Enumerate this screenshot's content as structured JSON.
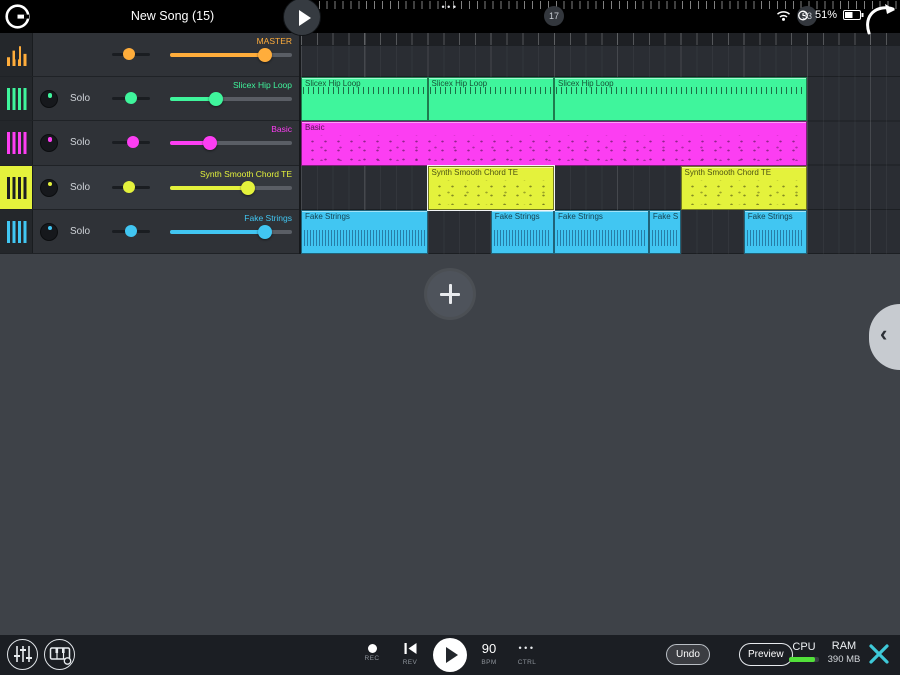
{
  "topbar": {
    "title": "New Song (15)",
    "menu_dots": "•••",
    "bar_badges": [
      {
        "label": "17",
        "bar": 17
      },
      {
        "label": "33",
        "bar": 33
      }
    ],
    "battery": "51%"
  },
  "tracks": [
    {
      "name": "MASTER",
      "color": "#FFAD3B",
      "icon": "level-meter",
      "solo": null,
      "pan": 0.45,
      "volume": 0.78
    },
    {
      "name": "Slicex Hip Loop",
      "color": "#3FF59C",
      "icon": "piano-roll",
      "solo": "Solo",
      "pan": 0.5,
      "volume": 0.38
    },
    {
      "name": "Basic",
      "color": "#FC3EF2",
      "icon": "piano-roll",
      "solo": "Solo",
      "pan": 0.55,
      "volume": 0.33
    },
    {
      "name": "Synth Smooth Chord TE",
      "color": "#E4F23C",
      "icon": "piano-roll",
      "solo": "Solo",
      "pan": 0.45,
      "volume": 0.64,
      "selected": true
    },
    {
      "name": "Fake Strings",
      "color": "#41C6F2",
      "icon": "piano-roll",
      "solo": "Solo",
      "pan": 0.5,
      "volume": 0.78
    }
  ],
  "clips": [
    {
      "row": 1,
      "bar": 1,
      "len": 8,
      "label": "Slicex Hip Loop",
      "kind": "slices"
    },
    {
      "row": 1,
      "bar": 9,
      "len": 8,
      "label": "Slicex Hip Loop",
      "kind": "slices"
    },
    {
      "row": 1,
      "bar": 17,
      "len": 16,
      "label": "Slicex Hip Loop",
      "kind": "slices"
    },
    {
      "row": 2,
      "bar": 1,
      "len": 32,
      "label": "Basic",
      "kind": "notes"
    },
    {
      "row": 3,
      "bar": 9,
      "len": 8,
      "label": "Synth Smooth Chord TE",
      "kind": "notes",
      "selected": true
    },
    {
      "row": 3,
      "bar": 25,
      "len": 8,
      "label": "Synth Smooth Chord TE",
      "kind": "notes"
    },
    {
      "row": 4,
      "bar": 1,
      "len": 8,
      "label": "Fake Strings",
      "kind": "wave"
    },
    {
      "row": 4,
      "bar": 13,
      "len": 4,
      "label": "Fake Strings",
      "kind": "wave"
    },
    {
      "row": 4,
      "bar": 17,
      "len": 6,
      "label": "Fake Strings",
      "kind": "wave"
    },
    {
      "row": 4,
      "bar": 23,
      "len": 2,
      "label": "Fake S...",
      "kind": "wave"
    },
    {
      "row": 4,
      "bar": 29,
      "len": 4,
      "label": "Fake Strings",
      "kind": "wave"
    }
  ],
  "transport": {
    "rec_label": "REC",
    "rev_label": "REV",
    "bpm_value": "90",
    "bpm_label": "BPM",
    "ctrl_dots": "•••",
    "ctrl_label": "CTRL"
  },
  "footer": {
    "undo": "Undo",
    "preview": "Preview",
    "cpu_label": "CPU",
    "cpu_level": 0.85,
    "ram_label": "RAM",
    "ram_value": "390 MB"
  },
  "colors": {
    "accent_teal": "#3EC9D8",
    "cpu_green": "#52E03A"
  }
}
